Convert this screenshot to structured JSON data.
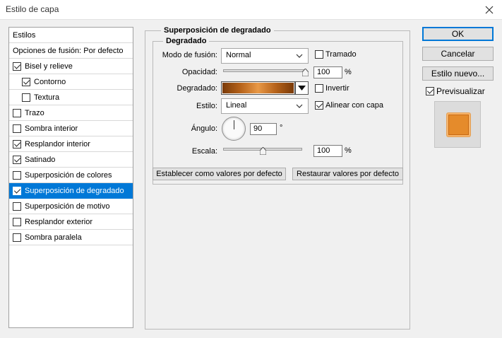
{
  "window": {
    "title": "Estilo de capa"
  },
  "sidebar": {
    "items": [
      {
        "label": "Estilos",
        "checkbox": false,
        "checked": false,
        "indent": 0,
        "selected": false
      },
      {
        "label": "Opciones de fusión: Por defecto",
        "checkbox": false,
        "checked": false,
        "indent": 0,
        "selected": false
      },
      {
        "label": "Bisel y relieve",
        "checkbox": true,
        "checked": true,
        "indent": 0,
        "selected": false
      },
      {
        "label": "Contorno",
        "checkbox": true,
        "checked": true,
        "indent": 1,
        "selected": false
      },
      {
        "label": "Textura",
        "checkbox": true,
        "checked": false,
        "indent": 1,
        "selected": false
      },
      {
        "label": "Trazo",
        "checkbox": true,
        "checked": false,
        "indent": 0,
        "selected": false
      },
      {
        "label": "Sombra interior",
        "checkbox": true,
        "checked": false,
        "indent": 0,
        "selected": false
      },
      {
        "label": "Resplandor interior",
        "checkbox": true,
        "checked": true,
        "indent": 0,
        "selected": false
      },
      {
        "label": "Satinado",
        "checkbox": true,
        "checked": true,
        "indent": 0,
        "selected": false
      },
      {
        "label": "Superposición de colores",
        "checkbox": true,
        "checked": false,
        "indent": 0,
        "selected": false
      },
      {
        "label": "Superposición de degradado",
        "checkbox": true,
        "checked": true,
        "indent": 0,
        "selected": true
      },
      {
        "label": "Superposición de motivo",
        "checkbox": true,
        "checked": false,
        "indent": 0,
        "selected": false
      },
      {
        "label": "Resplandor exterior",
        "checkbox": true,
        "checked": false,
        "indent": 0,
        "selected": false
      },
      {
        "label": "Sombra paralela",
        "checkbox": true,
        "checked": false,
        "indent": 0,
        "selected": false
      }
    ]
  },
  "panel": {
    "title": "Superposición de degradado",
    "group_title": "Degradado",
    "blend_mode": {
      "label": "Modo de fusión:",
      "value": "Normal"
    },
    "dither": {
      "label": "Tramado",
      "checked": false
    },
    "opacity": {
      "label": "Opacidad:",
      "value": "100",
      "unit": "%",
      "level": 1.0
    },
    "gradient": {
      "label": "Degradado:",
      "colors": [
        "#7a3a08",
        "#b5621a",
        "#e89846",
        "#b5621a",
        "#7a3a08"
      ]
    },
    "reverse": {
      "label": "Invertir",
      "checked": false
    },
    "style": {
      "label": "Estilo:",
      "value": "Lineal"
    },
    "align_with_layer": {
      "label": "Alinear con capa",
      "checked": true
    },
    "angle": {
      "label": "Ángulo:",
      "value": "90",
      "unit": "°"
    },
    "scale": {
      "label": "Escala:",
      "value": "100",
      "unit": "%",
      "level": 0.5
    },
    "buttons": {
      "make_default": "Establecer como valores por defecto",
      "reset_default": "Restaurar valores por defecto"
    }
  },
  "right": {
    "ok": "OK",
    "cancel": "Cancelar",
    "new_style": "Estilo nuevo...",
    "preview": {
      "label": "Previsualizar",
      "checked": true
    }
  },
  "colors": {
    "selection": "#0078d7",
    "preview_fill": "#e58b2b"
  }
}
